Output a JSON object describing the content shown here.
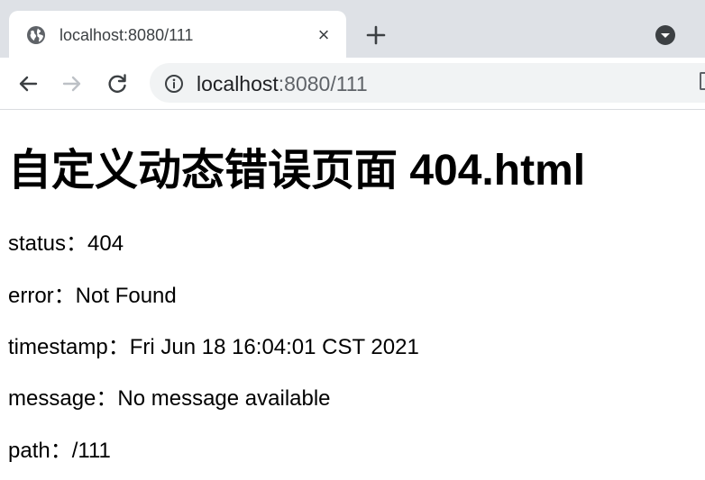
{
  "tab": {
    "title": "localhost:8080/111",
    "close_glyph": "×",
    "icon": "globe-icon"
  },
  "toolbar": {
    "url_host": "localhost",
    "url_rest": ":8080/111"
  },
  "page": {
    "heading": "自定义动态错误页面 404.html",
    "fields": [
      {
        "label": "status：",
        "value": "404"
      },
      {
        "label": "error：",
        "value": "Not Found"
      },
      {
        "label": "timestamp：",
        "value": "Fri Jun 18 16:04:01 CST 2021"
      },
      {
        "label": "message：",
        "value": "No message available"
      },
      {
        "label": "path：",
        "value": "/111"
      }
    ]
  },
  "colors": {
    "tabstrip": "#dee1e6",
    "omnibox": "#f1f3f4",
    "icon": "#5f6368"
  }
}
